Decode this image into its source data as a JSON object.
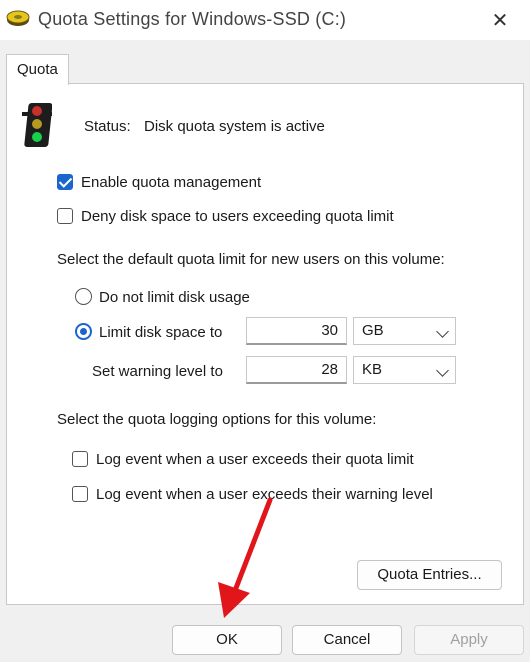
{
  "window": {
    "title": "Quota Settings for Windows-SSD (C:)",
    "close_glyph": "✕"
  },
  "tab": {
    "label": "Quota"
  },
  "status": {
    "label": "Status:",
    "value": "Disk quota system is active"
  },
  "options": {
    "enable_quota": {
      "label": "Enable quota management",
      "checked": true
    },
    "deny_space": {
      "label": "Deny disk space to users exceeding quota limit",
      "checked": false
    }
  },
  "default_limit": {
    "heading": "Select the default quota limit for new users on this volume:",
    "no_limit": {
      "label": "Do not limit disk usage",
      "selected": false
    },
    "limit": {
      "label": "Limit disk space to",
      "selected": true,
      "value": "30",
      "unit": "GB"
    },
    "warning": {
      "label": "Set warning level to",
      "value": "28",
      "unit": "KB"
    }
  },
  "logging": {
    "heading": "Select the quota logging options for this volume:",
    "log_limit": {
      "label": "Log event when a user exceeds their quota limit",
      "checked": false
    },
    "log_warning": {
      "label": "Log event when a user exceeds their warning level",
      "checked": false
    }
  },
  "buttons": {
    "quota_entries": "Quota Entries...",
    "ok": "OK",
    "cancel": "Cancel",
    "apply": "Apply"
  },
  "colors": {
    "accent": "#1a66cc",
    "annotation_arrow": "#e0161b"
  }
}
